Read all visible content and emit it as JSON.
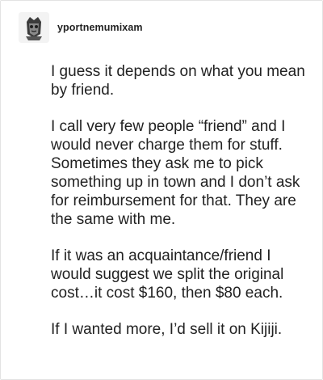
{
  "post": {
    "username": "yportnemumixam",
    "avatar_icon": "avatar-illustration-icon",
    "paragraphs": [
      "I guess it depends on what you mean by friend.",
      "I call very few people “friend” and I would never charge them for stuff. Sometimes they ask me to pick something up in town and I don’t ask for reimbursement for that. They are the same with me.",
      "If it was an acquaintance/friend I would suggest we split the original cost…it cost $160, then $80 each.",
      "If I wanted more, I’d sell it on Kijiji."
    ]
  }
}
